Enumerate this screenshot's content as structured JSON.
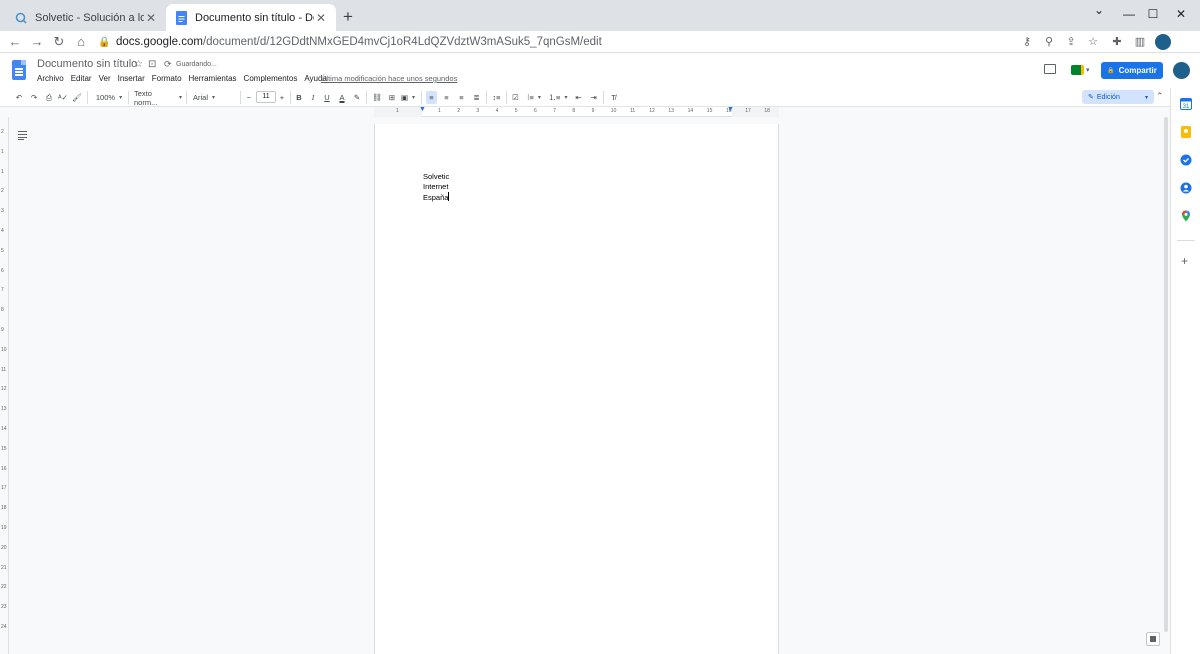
{
  "browser": {
    "tabs": [
      {
        "title": "Solvetic - Solución a los problemas",
        "active": false
      },
      {
        "title": "Documento sin título - Documentos de Google",
        "active": true
      }
    ],
    "new_tab": "+",
    "window_controls": {
      "minimize": "—",
      "maximize": "☐",
      "close": "✕"
    },
    "url_host": "docs.google.com",
    "url_path": "/document/d/12GDdtNMxGED4mvCj1oR4LdQZVdztW3mASuk5_7qnGsM/edit"
  },
  "docs": {
    "title": "Documento sin título",
    "saving_status": "Guardando...",
    "menu": [
      "Archivo",
      "Editar",
      "Ver",
      "Insertar",
      "Formato",
      "Herramientas",
      "Complementos",
      "Ayuda"
    ],
    "last_edit": "Última modificación hace unos segundos",
    "share_label": "Compartir",
    "share_icon": "🔒"
  },
  "toolbar": {
    "zoom": "100%",
    "style": "Texto norm...",
    "font": "Arial",
    "font_size": "11",
    "bold": "B",
    "italic": "I",
    "underline": "U",
    "text_color": "A",
    "mode": "Edición"
  },
  "ruler": {
    "h_numbers": [
      "1",
      "1",
      "2",
      "3",
      "4",
      "5",
      "6",
      "7",
      "8",
      "9",
      "10",
      "11",
      "12",
      "13",
      "14",
      "15",
      "16",
      "17",
      "18"
    ],
    "v_numbers": [
      "2",
      "1",
      "1",
      "2",
      "3",
      "4",
      "5",
      "6",
      "7",
      "8",
      "9",
      "10",
      "11",
      "12",
      "13",
      "14",
      "15",
      "16",
      "17",
      "18",
      "19",
      "20",
      "21",
      "22",
      "23",
      "24"
    ]
  },
  "document": {
    "lines": [
      "Solvetic",
      "Internet",
      "España"
    ]
  },
  "colors": {
    "accent": "#1a73e8",
    "docs_blue": "#4285f4",
    "mode_bg": "#d3e3fd"
  }
}
